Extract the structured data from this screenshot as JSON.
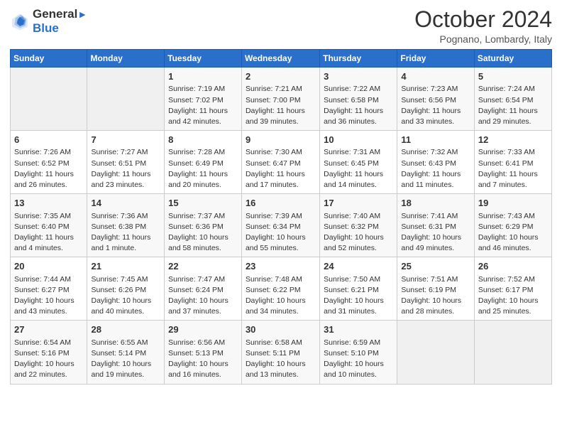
{
  "header": {
    "logo_line1": "General",
    "logo_line2": "Blue",
    "month": "October 2024",
    "location": "Pognano, Lombardy, Italy"
  },
  "weekdays": [
    "Sunday",
    "Monday",
    "Tuesday",
    "Wednesday",
    "Thursday",
    "Friday",
    "Saturday"
  ],
  "weeks": [
    [
      {
        "day": "",
        "info": ""
      },
      {
        "day": "",
        "info": ""
      },
      {
        "day": "1",
        "info": "Sunrise: 7:19 AM\nSunset: 7:02 PM\nDaylight: 11 hours and 42 minutes."
      },
      {
        "day": "2",
        "info": "Sunrise: 7:21 AM\nSunset: 7:00 PM\nDaylight: 11 hours and 39 minutes."
      },
      {
        "day": "3",
        "info": "Sunrise: 7:22 AM\nSunset: 6:58 PM\nDaylight: 11 hours and 36 minutes."
      },
      {
        "day": "4",
        "info": "Sunrise: 7:23 AM\nSunset: 6:56 PM\nDaylight: 11 hours and 33 minutes."
      },
      {
        "day": "5",
        "info": "Sunrise: 7:24 AM\nSunset: 6:54 PM\nDaylight: 11 hours and 29 minutes."
      }
    ],
    [
      {
        "day": "6",
        "info": "Sunrise: 7:26 AM\nSunset: 6:52 PM\nDaylight: 11 hours and 26 minutes."
      },
      {
        "day": "7",
        "info": "Sunrise: 7:27 AM\nSunset: 6:51 PM\nDaylight: 11 hours and 23 minutes."
      },
      {
        "day": "8",
        "info": "Sunrise: 7:28 AM\nSunset: 6:49 PM\nDaylight: 11 hours and 20 minutes."
      },
      {
        "day": "9",
        "info": "Sunrise: 7:30 AM\nSunset: 6:47 PM\nDaylight: 11 hours and 17 minutes."
      },
      {
        "day": "10",
        "info": "Sunrise: 7:31 AM\nSunset: 6:45 PM\nDaylight: 11 hours and 14 minutes."
      },
      {
        "day": "11",
        "info": "Sunrise: 7:32 AM\nSunset: 6:43 PM\nDaylight: 11 hours and 11 minutes."
      },
      {
        "day": "12",
        "info": "Sunrise: 7:33 AM\nSunset: 6:41 PM\nDaylight: 11 hours and 7 minutes."
      }
    ],
    [
      {
        "day": "13",
        "info": "Sunrise: 7:35 AM\nSunset: 6:40 PM\nDaylight: 11 hours and 4 minutes."
      },
      {
        "day": "14",
        "info": "Sunrise: 7:36 AM\nSunset: 6:38 PM\nDaylight: 11 hours and 1 minute."
      },
      {
        "day": "15",
        "info": "Sunrise: 7:37 AM\nSunset: 6:36 PM\nDaylight: 10 hours and 58 minutes."
      },
      {
        "day": "16",
        "info": "Sunrise: 7:39 AM\nSunset: 6:34 PM\nDaylight: 10 hours and 55 minutes."
      },
      {
        "day": "17",
        "info": "Sunrise: 7:40 AM\nSunset: 6:32 PM\nDaylight: 10 hours and 52 minutes."
      },
      {
        "day": "18",
        "info": "Sunrise: 7:41 AM\nSunset: 6:31 PM\nDaylight: 10 hours and 49 minutes."
      },
      {
        "day": "19",
        "info": "Sunrise: 7:43 AM\nSunset: 6:29 PM\nDaylight: 10 hours and 46 minutes."
      }
    ],
    [
      {
        "day": "20",
        "info": "Sunrise: 7:44 AM\nSunset: 6:27 PM\nDaylight: 10 hours and 43 minutes."
      },
      {
        "day": "21",
        "info": "Sunrise: 7:45 AM\nSunset: 6:26 PM\nDaylight: 10 hours and 40 minutes."
      },
      {
        "day": "22",
        "info": "Sunrise: 7:47 AM\nSunset: 6:24 PM\nDaylight: 10 hours and 37 minutes."
      },
      {
        "day": "23",
        "info": "Sunrise: 7:48 AM\nSunset: 6:22 PM\nDaylight: 10 hours and 34 minutes."
      },
      {
        "day": "24",
        "info": "Sunrise: 7:50 AM\nSunset: 6:21 PM\nDaylight: 10 hours and 31 minutes."
      },
      {
        "day": "25",
        "info": "Sunrise: 7:51 AM\nSunset: 6:19 PM\nDaylight: 10 hours and 28 minutes."
      },
      {
        "day": "26",
        "info": "Sunrise: 7:52 AM\nSunset: 6:17 PM\nDaylight: 10 hours and 25 minutes."
      }
    ],
    [
      {
        "day": "27",
        "info": "Sunrise: 6:54 AM\nSunset: 5:16 PM\nDaylight: 10 hours and 22 minutes."
      },
      {
        "day": "28",
        "info": "Sunrise: 6:55 AM\nSunset: 5:14 PM\nDaylight: 10 hours and 19 minutes."
      },
      {
        "day": "29",
        "info": "Sunrise: 6:56 AM\nSunset: 5:13 PM\nDaylight: 10 hours and 16 minutes."
      },
      {
        "day": "30",
        "info": "Sunrise: 6:58 AM\nSunset: 5:11 PM\nDaylight: 10 hours and 13 minutes."
      },
      {
        "day": "31",
        "info": "Sunrise: 6:59 AM\nSunset: 5:10 PM\nDaylight: 10 hours and 10 minutes."
      },
      {
        "day": "",
        "info": ""
      },
      {
        "day": "",
        "info": ""
      }
    ]
  ]
}
